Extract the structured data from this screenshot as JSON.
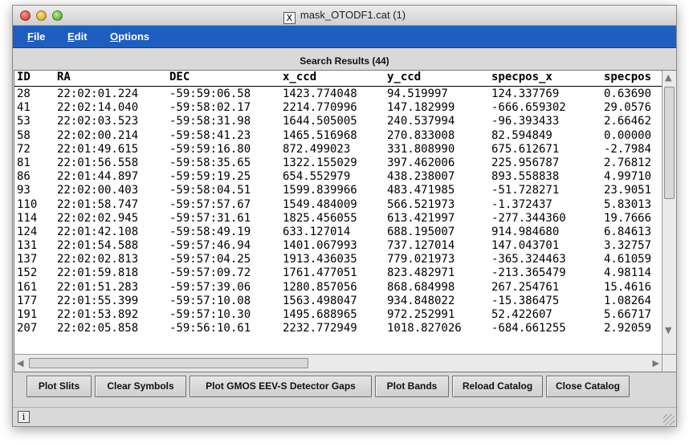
{
  "window": {
    "title": "mask_OTODF1.cat (1)",
    "app_icon": "x11-icon"
  },
  "menu": {
    "file": {
      "mnemonic": "F",
      "rest": "ile"
    },
    "edit": {
      "mnemonic": "E",
      "rest": "dit"
    },
    "options": {
      "mnemonic": "O",
      "rest": "ptions"
    }
  },
  "results": {
    "header": "Search Results (44)",
    "columns": [
      "ID",
      "RA",
      "DEC",
      "x_ccd",
      "y_ccd",
      "specpos_x",
      "specpos"
    ],
    "rows": [
      [
        "28",
        "22:02:01.224",
        "-59:59:06.58",
        "1423.774048",
        "94.519997",
        "124.337769",
        "0.63690"
      ],
      [
        "41",
        "22:02:14.040",
        "-59:58:02.17",
        "2214.770996",
        "147.182999",
        "-666.659302",
        "29.0576"
      ],
      [
        "53",
        "22:02:03.523",
        "-59:58:31.98",
        "1644.505005",
        "240.537994",
        "-96.393433",
        "2.66462"
      ],
      [
        "58",
        "22:02:00.214",
        "-59:58:41.23",
        "1465.516968",
        "270.833008",
        "82.594849",
        "0.00000"
      ],
      [
        "72",
        "22:01:49.615",
        "-59:59:16.80",
        "872.499023",
        "331.808990",
        "675.612671",
        "-2.7984"
      ],
      [
        "81",
        "22:01:56.558",
        "-59:58:35.65",
        "1322.155029",
        "397.462006",
        "225.956787",
        "2.76812"
      ],
      [
        "86",
        "22:01:44.897",
        "-59:59:19.25",
        "654.552979",
        "438.238007",
        "893.558838",
        "4.99710"
      ],
      [
        "93",
        "22:02:00.403",
        "-59:58:04.51",
        "1599.839966",
        "483.471985",
        "-51.728271",
        "23.9051"
      ],
      [
        "110",
        "22:01:58.747",
        "-59:57:57.67",
        "1549.484009",
        "566.521973",
        "-1.372437",
        "5.83013"
      ],
      [
        "114",
        "22:02:02.945",
        "-59:57:31.61",
        "1825.456055",
        "613.421997",
        "-277.344360",
        "19.7666"
      ],
      [
        "124",
        "22:01:42.108",
        "-59:58:49.19",
        "633.127014",
        "688.195007",
        "914.984680",
        "6.84613"
      ],
      [
        "131",
        "22:01:54.588",
        "-59:57:46.94",
        "1401.067993",
        "737.127014",
        "147.043701",
        "3.32757"
      ],
      [
        "137",
        "22:02:02.813",
        "-59:57:04.25",
        "1913.436035",
        "779.021973",
        "-365.324463",
        "4.61059"
      ],
      [
        "152",
        "22:01:59.818",
        "-59:57:09.72",
        "1761.477051",
        "823.482971",
        "-213.365479",
        "4.98114"
      ],
      [
        "161",
        "22:01:51.283",
        "-59:57:39.06",
        "1280.857056",
        "868.684998",
        "267.254761",
        "15.4616"
      ],
      [
        "177",
        "22:01:55.399",
        "-59:57:10.08",
        "1563.498047",
        "934.848022",
        "-15.386475",
        "1.08264"
      ],
      [
        "191",
        "22:01:53.892",
        "-59:57:10.30",
        "1495.688965",
        "972.252991",
        "52.422607",
        "5.66717"
      ],
      [
        "207",
        "22:02:05.858",
        "-59:56:10.61",
        "2232.772949",
        "1018.827026",
        "-684.661255",
        "2.92059"
      ]
    ]
  },
  "buttons": {
    "plot_slits": "Plot Slits",
    "clear_symbols": "Clear Symbols",
    "plot_gmos": "Plot GMOS EEV-S Detector Gaps",
    "plot_bands": "Plot Bands",
    "reload_catalog": "Reload Catalog",
    "close_catalog": "Close Catalog"
  },
  "status": {
    "info_icon": "i"
  },
  "colors": {
    "menubar": "#1e5ec0",
    "window_bg": "#d9d9d9"
  }
}
